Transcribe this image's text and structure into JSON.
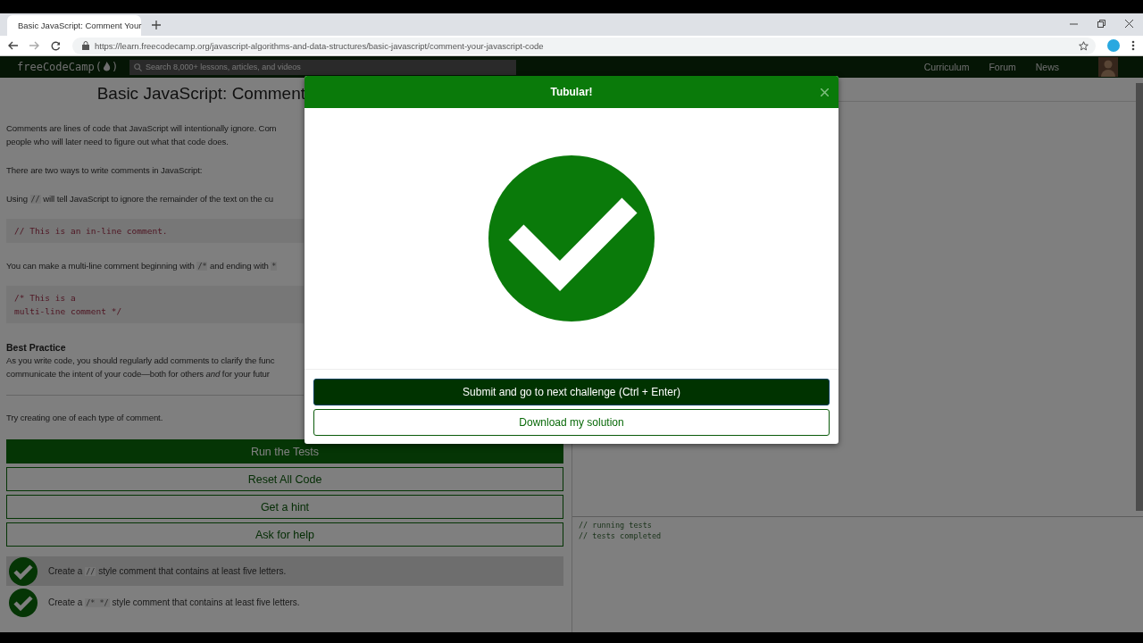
{
  "browser": {
    "tab_title": "Basic JavaScript: Comment Your",
    "url": "https://learn.freecodecamp.org/javascript-algorithms-and-data-structures/basic-javascript/comment-your-javascript-code"
  },
  "nav": {
    "logo": {
      "name": "freeCodeCamp",
      "open": "(",
      "close": ")"
    },
    "search": {
      "placeholder": "Search 8,000+ lessons, articles, and videos"
    },
    "links": [
      "Curriculum",
      "Forum",
      "News"
    ]
  },
  "lesson": {
    "title": "Basic JavaScript: Comment",
    "blocks": [
      {
        "kind": "para",
        "segments": [
          {
            "kind": "text",
            "text": "Comments are lines of code that JavaScript will intentionally ignore. Com\npeople who will later need to figure out what that code does."
          }
        ]
      },
      {
        "kind": "para",
        "segments": [
          {
            "kind": "text",
            "text": "There are two ways to write comments in JavaScript:"
          }
        ]
      },
      {
        "kind": "para",
        "segments": [
          {
            "kind": "text",
            "text": "Using "
          },
          {
            "kind": "code",
            "text": "//"
          },
          {
            "kind": "text",
            "text": " will tell JavaScript to ignore the remainder of the text on the cu"
          }
        ]
      },
      {
        "kind": "code",
        "lines": [
          "// This is an in-line comment."
        ]
      },
      {
        "kind": "para",
        "segments": [
          {
            "kind": "text",
            "text": "You can make a multi-line comment beginning with "
          },
          {
            "kind": "code",
            "text": "/*"
          },
          {
            "kind": "text",
            "text": " and ending with "
          },
          {
            "kind": "code",
            "text": "*"
          }
        ]
      },
      {
        "kind": "code",
        "lines": [
          "/* This is a",
          "multi-line comment */"
        ]
      },
      {
        "kind": "heading",
        "text": "Best Practice"
      },
      {
        "kind": "para",
        "segments": [
          {
            "kind": "text",
            "text": "As you write code, you should regularly add comments to clarify the func\ncommunicate the intent of your code—both for others *and* for your futur"
          }
        ],
        "tight": true
      },
      {
        "kind": "rule"
      },
      {
        "kind": "para",
        "segments": [
          {
            "kind": "text",
            "text": "Try creating one of each type of comment."
          }
        ]
      }
    ],
    "buttons": [
      {
        "label": "Run the Tests",
        "primary": true
      },
      {
        "label": "Reset All Code",
        "primary": false
      },
      {
        "label": "Get a hint",
        "primary": false
      },
      {
        "label": "Ask for help",
        "primary": false
      }
    ],
    "tests": [
      {
        "passed": true,
        "highlighted": true,
        "segments": [
          {
            "kind": "text",
            "text": "Create a "
          },
          {
            "kind": "code",
            "text": "//"
          },
          {
            "kind": "text",
            "text": " style comment that contains at least five letters."
          }
        ]
      },
      {
        "passed": true,
        "highlighted": false,
        "segments": [
          {
            "kind": "text",
            "text": "Create a "
          },
          {
            "kind": "code",
            "text": "/* */"
          },
          {
            "kind": "text",
            "text": " style comment that contains at least five letters."
          }
        ]
      }
    ]
  },
  "console": [
    "// running tests",
    "// tests completed"
  ],
  "modal": {
    "title": "Tubular!",
    "passed": true,
    "buttons": [
      {
        "label": "Submit and go to next challenge (Ctrl + Enter)",
        "primary": true
      },
      {
        "label": "Download my solution",
        "primary": false
      }
    ]
  }
}
